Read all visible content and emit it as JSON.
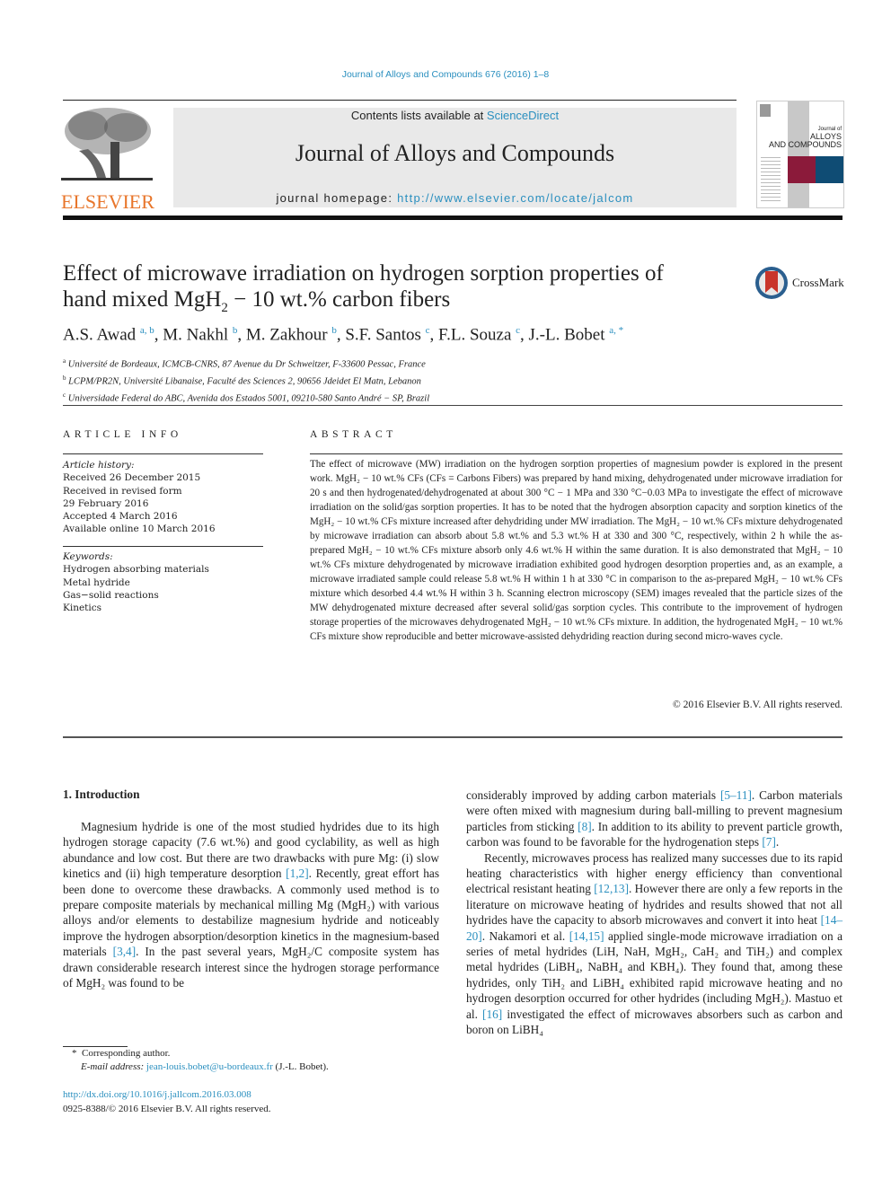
{
  "running_header": "Journal of Alloys and Compounds 676 (2016) 1–8",
  "masthead": {
    "publisher_logo": "ELSEVIER",
    "contents_prefix": "Contents lists available at ",
    "contents_link": "ScienceDirect",
    "journal_title": "Journal of Alloys and Compounds",
    "homepage_prefix": "journal homepage: ",
    "homepage_url": "http://www.elsevier.com/locate/jalcom",
    "cover": {
      "line1": "Journal of",
      "line2": "ALLOYS",
      "line3": "AND COMPOUNDS",
      "colors": {
        "red": "#8b1a3a",
        "blue": "#0f4c74",
        "gray": "#c8c8c8"
      }
    }
  },
  "article": {
    "title_line1": "Effect of microwave irradiation on hydrogen sorption properties of",
    "title_line2_pre": "hand mixed MgH",
    "title_line2_sub": "2",
    "title_line2_post": " − 10 wt.% carbon fibers",
    "crossmark_label": "CrossMark",
    "authors": [
      {
        "name": "A.S. Awad",
        "aff": "a, b"
      },
      {
        "name": "M. Nakhl",
        "aff": "b"
      },
      {
        "name": "M. Zakhour",
        "aff": "b"
      },
      {
        "name": "S.F. Santos",
        "aff": "c"
      },
      {
        "name": "F.L. Souza",
        "aff": "c"
      },
      {
        "name": "J.-L. Bobet",
        "aff": "a, *"
      }
    ],
    "affiliations": [
      {
        "key": "a",
        "text": "Université de Bordeaux, ICMCB-CNRS, 87 Avenue du Dr Schweitzer, F-33600 Pessac, France"
      },
      {
        "key": "b",
        "text": "LCPM/PR2N, Université Libanaise, Faculté des Sciences 2, 90656 Jdeidet El Matn, Lebanon"
      },
      {
        "key": "c",
        "text": "Universidade Federal do ABC, Avenida dos Estados 5001, 09210-580 Santo André − SP, Brazil"
      }
    ]
  },
  "article_info": {
    "heading": "ARTICLE INFO",
    "history_label": "Article history:",
    "history": [
      "Received 26 December 2015",
      "Received in revised form",
      "29 February 2016",
      "Accepted 4 March 2016",
      "Available online 10 March 2016"
    ],
    "keywords_label": "Keywords:",
    "keywords": [
      "Hydrogen absorbing materials",
      "Metal hydride",
      "Gas−solid reactions",
      "Kinetics"
    ]
  },
  "abstract": {
    "heading": "ABSTRACT",
    "text": "The effect of microwave (MW) irradiation on the hydrogen sorption properties of magnesium powder is explored in the present work. MgH₂ − 10 wt.% CFs (CFs = Carbons Fibers) was prepared by hand mixing, dehydrogenated under microwave irradiation for 20 s and then hydrogenated/dehydrogenated at about 300 °C − 1 MPa and 330 °C−0.03 MPa to investigate the effect of microwave irradiation on the solid/gas sorption properties. It has to be noted that the hydrogen absorption capacity and sorption kinetics of the MgH₂ − 10 wt.% CFs mixture increased after dehydriding under MW irradiation. The MgH₂ − 10 wt.% CFs mixture dehydrogenated by microwave irradiation can absorb about 5.8 wt.% and 5.3 wt.% H at 330 and 300 °C, respectively, within 2 h while the as-prepared MgH₂ − 10 wt.% CFs mixture absorb only 4.6 wt.% H within the same duration. It is also demonstrated that MgH₂ − 10 wt.% CFs mixture dehydrogenated by microwave irradiation exhibited good hydrogen desorption properties and, as an example, a microwave irradiated sample could release 5.8 wt.% H within 1 h at 330 °C in comparison to the as-prepared MgH₂ − 10 wt.% CFs mixture which desorbed 4.4 wt.% H within 3 h. Scanning electron microscopy (SEM) images revealed that the particle sizes of the MW dehydrogenated mixture decreased after several solid/gas sorption cycles. This contribute to the improvement of hydrogen storage properties of the microwaves dehydrogenated MgH₂ − 10 wt.% CFs mixture. In addition, the hydrogenated MgH₂ − 10 wt.% CFs mixture show reproducible and better microwave-assisted dehydriding reaction during second micro-waves cycle.",
    "copyright": "© 2016 Elsevier B.V. All rights reserved."
  },
  "introduction": {
    "heading": "1.  Introduction",
    "left_para": [
      {
        "t": "Magnesium hydride is one of the most studied hydrides due to its high hydrogen storage capacity (7.6 wt.%) and good cyclability, as well as high abundance and low cost. But there are two drawbacks with pure Mg: (i) slow kinetics and (ii) high temperature desorption "
      },
      {
        "ref": "[1,2]"
      },
      {
        "t": ". Recently, great effort has been done to overcome these drawbacks. A commonly used method is to prepare composite materials by mechanical milling Mg (MgH₂) with various alloys and/or elements to destabilize magnesium hydride and noticeably improve the hydrogen absorption/desorption kinetics in the magnesium-based materials "
      },
      {
        "ref": "[3,4]"
      },
      {
        "t": ". In the past several years, MgH₂/C composite system has drawn considerable research interest since the hydrogen storage performance of MgH₂ was found to be"
      }
    ],
    "right_para1": [
      {
        "t": "considerably improved by adding carbon materials "
      },
      {
        "ref": "[5–11]"
      },
      {
        "t": ". Carbon materials were often mixed with magnesium during ball-milling to prevent magnesium particles from sticking "
      },
      {
        "ref": "[8]"
      },
      {
        "t": ". In addition to its ability to prevent particle growth, carbon was found to be favorable for the hydrogenation steps "
      },
      {
        "ref": "[7]"
      },
      {
        "t": "."
      }
    ],
    "right_para2": [
      {
        "t": "Recently, microwaves process has realized many successes due to its rapid heating characteristics with higher energy efficiency than conventional electrical resistant heating "
      },
      {
        "ref": "[12,13]"
      },
      {
        "t": ". However there are only a few reports in the literature on microwave heating of hydrides and results showed that not all hydrides have the capacity to absorb microwaves and convert it into heat "
      },
      {
        "ref": "[14–20]"
      },
      {
        "t": ". Nakamori et al. "
      },
      {
        "ref": "[14,15]"
      },
      {
        "t": " applied single-mode microwave irradiation on a series of metal hydrides (LiH, NaH, MgH₂, CaH₂ and TiH₂) and complex metal hydrides (LiBH₄, NaBH₄ and KBH₄). They found that, among these hydrides, only TiH₂ and LiBH₄ exhibited rapid microwave heating and no hydrogen desorption occurred for other hydrides (including MgH₂). Mastuo et al. "
      },
      {
        "ref": "[16]"
      },
      {
        "t": " investigated the effect of microwaves absorbers such as carbon and boron on LiBH₄"
      }
    ]
  },
  "footnote": {
    "star": "*",
    "corresponding": "Corresponding author.",
    "email_label": "E-mail address:",
    "email": "jean-louis.bobet@u-bordeaux.fr",
    "email_owner": "(J.-L. Bobet)."
  },
  "doi": {
    "url": "http://dx.doi.org/10.1016/j.jallcom.2016.03.008",
    "issn_line": "0925-8388/© 2016 Elsevier B.V. All rights reserved."
  }
}
